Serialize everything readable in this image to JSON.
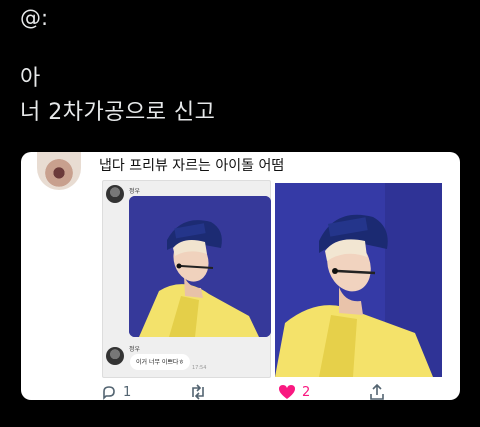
{
  "tweet": {
    "handle": "@:",
    "line1": "아",
    "line2": "너 2차가공으로 신고"
  },
  "quote": {
    "title": "냅다 프리뷰 자르는 아이돌 어떰",
    "chat": {
      "sender": "정우",
      "sender2": "정우",
      "message": "이거 너무 이쁘다ㅎ",
      "time": "17:54"
    }
  },
  "actions": {
    "replies": "1",
    "likes": "2"
  },
  "colors": {
    "background": "#000000",
    "like": "#f91880",
    "photo_bg": "#353aa6"
  }
}
